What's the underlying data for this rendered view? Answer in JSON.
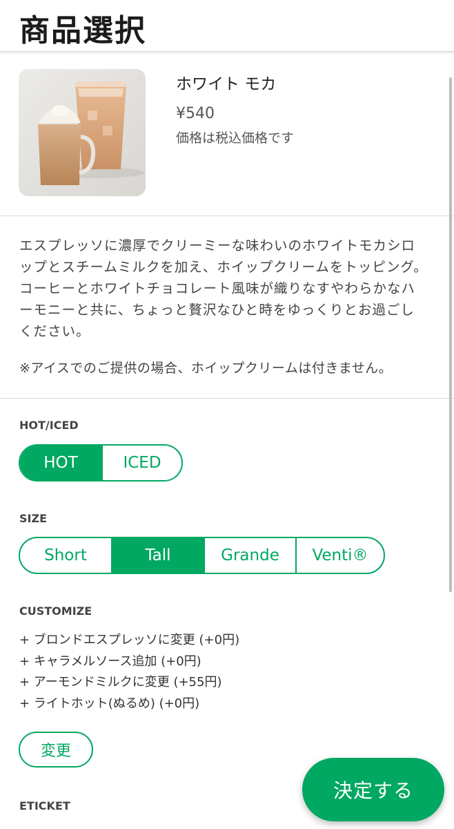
{
  "header": {
    "title": "商品選択"
  },
  "product": {
    "image": "white-mocha-drinks-image",
    "name": "ホワイト モカ",
    "price": "¥540",
    "tax_note": "価格は税込価格です",
    "description": "エスプレッソに濃厚でクリーミーな味わいのホワイトモカシロップとスチームミルクを加え、ホイップクリームをトッピング。コーヒーとホワイトチョコレート風味が織りなすやわらかなハーモニーと共に、ちょっと贅沢なひと時をゆっくりとお過ごしください。",
    "notice": "※アイスでのご提供の場合、ホイップクリームは付きません。"
  },
  "hot_iced": {
    "label": "HOT/ICED",
    "options": [
      "HOT",
      "ICED"
    ],
    "selected": "HOT"
  },
  "size": {
    "label": "SIZE",
    "options": [
      "Short",
      "Tall",
      "Grande",
      "Venti®"
    ],
    "selected": "Tall"
  },
  "customize": {
    "label": "CUSTOMIZE",
    "items": [
      "+ ブロンドエスプレッソに変更 (+0円)",
      "+ キャラメルソース追加 (+0円)",
      "+ アーモンドミルクに変更 (+55円)",
      "+ ライトホット(ぬるめ) (+0円)"
    ],
    "change_label": "変更"
  },
  "eticket": {
    "label": "ETICKET"
  },
  "actions": {
    "decide_label": "決定する"
  },
  "colors": {
    "accent": "#00a862",
    "text": "#222222",
    "muted": "#555555"
  }
}
